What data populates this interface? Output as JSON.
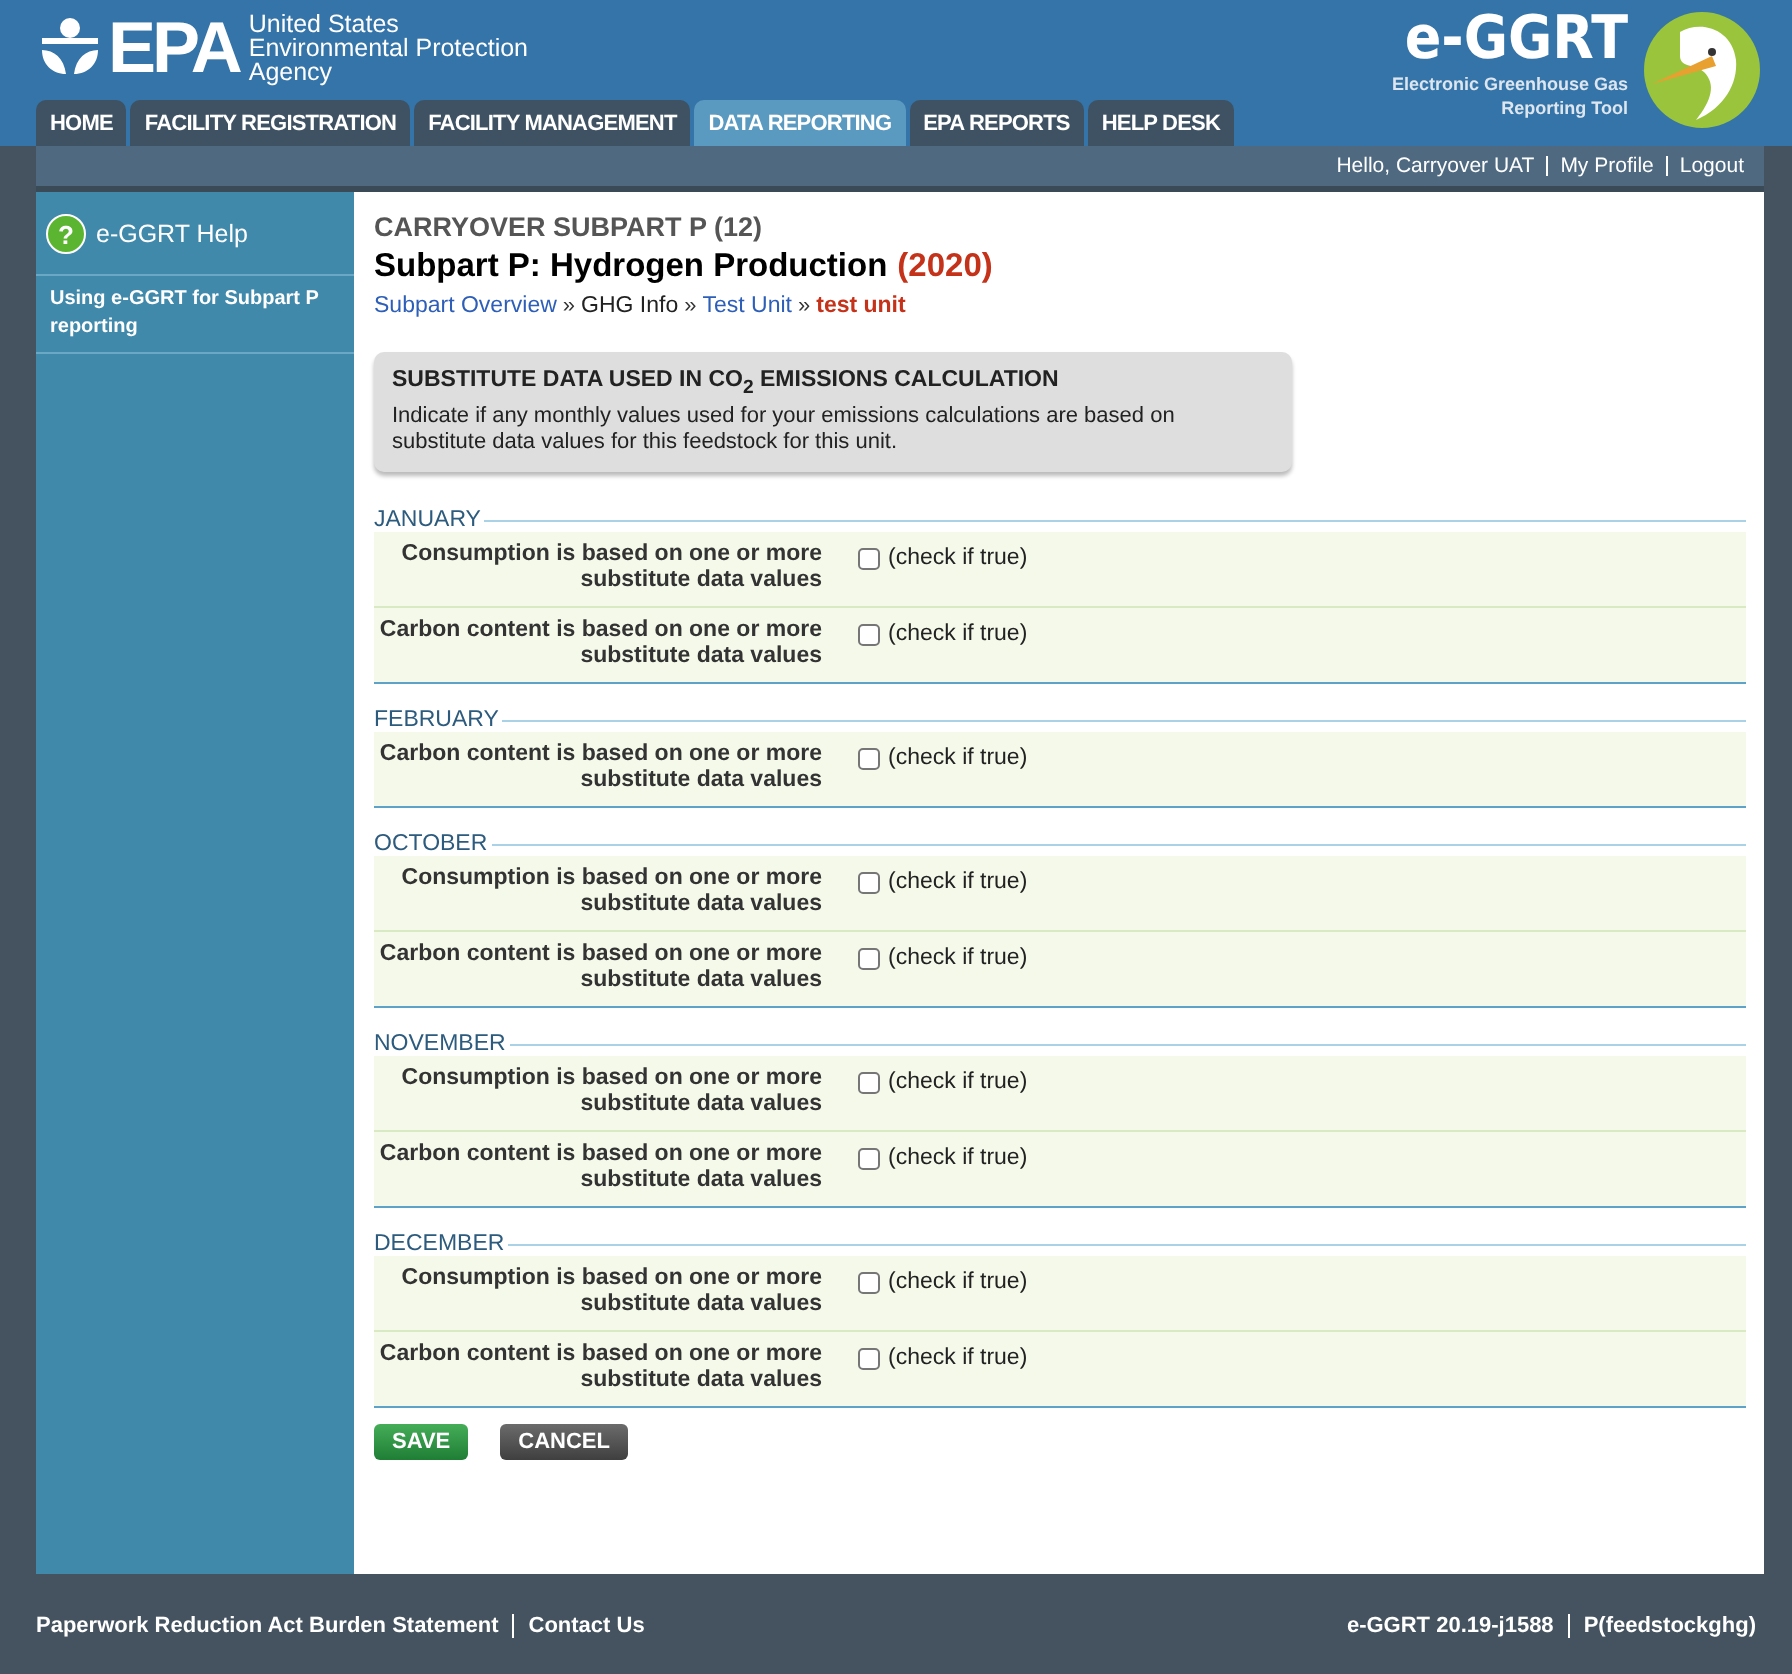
{
  "header": {
    "agency_mark": "EPA",
    "agency_name": [
      "United States",
      "Environmental Protection",
      "Agency"
    ],
    "tool_name": "e-GGRT",
    "tool_subtitle": [
      "Electronic Greenhouse Gas",
      "Reporting Tool"
    ]
  },
  "tabs": [
    {
      "label": "HOME",
      "selected": false
    },
    {
      "label": "FACILITY REGISTRATION",
      "selected": false
    },
    {
      "label": "FACILITY MANAGEMENT",
      "selected": false
    },
    {
      "label": "DATA REPORTING",
      "selected": true
    },
    {
      "label": "EPA REPORTS",
      "selected": false
    },
    {
      "label": "HELP DESK",
      "selected": false
    }
  ],
  "user_links": [
    "Hello, Carryover UAT",
    "My Profile",
    "Logout"
  ],
  "sidebar": {
    "help_icon": "?",
    "title": "e-GGRT Help",
    "items": [
      "Using e-GGRT for Subpart P reporting"
    ]
  },
  "page": {
    "kicker": "CARRYOVER SUBPART P (12)",
    "title": "Subpart P: Hydrogen Production",
    "year": "(2020)",
    "breadcrumb": [
      {
        "label": "Subpart Overview",
        "kind": "link"
      },
      {
        "label": "»",
        "kind": "separator"
      },
      {
        "label": "GHG Info",
        "kind": "text"
      },
      {
        "label": "»",
        "kind": "separator"
      },
      {
        "label": "Test Unit",
        "kind": "link"
      },
      {
        "label": "»",
        "kind": "separator"
      },
      {
        "label": "test unit",
        "kind": "current"
      }
    ]
  },
  "notice": {
    "title": "SUBSTITUTE DATA USED IN CO$_{2}$ EMISSIONS CALCULATION",
    "text": "Indicate if any monthly values used for your emissions calculations are based on substitute data values for this feedstock for this unit."
  },
  "months": [
    {
      "name": "JANUARY",
      "rows": [
        {
          "label": "Consumption is based on one or more substitute data values",
          "checked": false,
          "hint": "(check if true)"
        },
        {
          "label": "Carbon content is based on one or more substitute data values",
          "checked": false,
          "hint": "(check if true)"
        }
      ]
    },
    {
      "name": "FEBRUARY",
      "rows": [
        {
          "label": "Carbon content is based on one or more substitute data values",
          "checked": false,
          "hint": "(check if true)"
        }
      ]
    },
    {
      "name": "OCTOBER",
      "rows": [
        {
          "label": "Consumption is based on one or more substitute data values",
          "checked": false,
          "hint": "(check if true)"
        },
        {
          "label": "Carbon content is based on one or more substitute data values",
          "checked": false,
          "hint": "(check if true)"
        }
      ]
    },
    {
      "name": "NOVEMBER",
      "rows": [
        {
          "label": "Consumption is based on one or more substitute data values",
          "checked": false,
          "hint": "(check if true)"
        },
        {
          "label": "Carbon content is based on one or more substitute data values",
          "checked": false,
          "hint": "(check if true)"
        }
      ]
    },
    {
      "name": "DECEMBER",
      "rows": [
        {
          "label": "Consumption is based on one or more substitute data values",
          "checked": false,
          "hint": "(check if true)"
        },
        {
          "label": "Carbon content is based on one or more substitute data values",
          "checked": false,
          "hint": "(check if true)"
        }
      ]
    }
  ],
  "buttons": [
    {
      "label": "SAVE",
      "kind": "primary"
    },
    {
      "label": "CANCEL",
      "kind": "secondary"
    }
  ],
  "footer": {
    "left": [
      "Paperwork Reduction Act Burden Statement",
      "Contact Us"
    ],
    "right": [
      "e-GGRT 20.19-j1588",
      "P(feedstockghg)"
    ]
  }
}
